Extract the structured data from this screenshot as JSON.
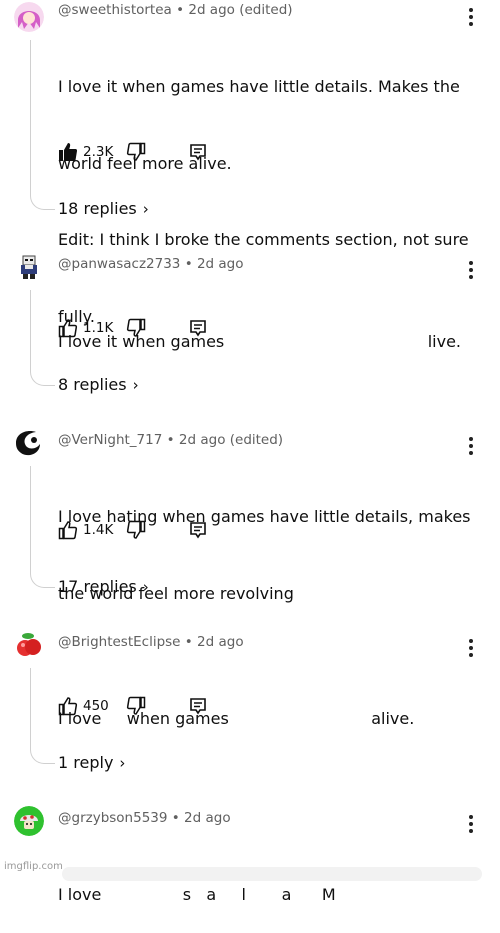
{
  "comments": [
    {
      "avatar": "pink-haired-anime-avatar",
      "handle": "@sweethistortea",
      "time": "2d ago (edited)",
      "lines": [
        "I love it when games have little details. Makes the",
        "world feel more alive.",
        "Edit: I think I broke the comments section, not sure",
        "fully."
      ],
      "likes": "2.3K",
      "liked": true,
      "replies": "18 replies"
    },
    {
      "avatar": "pixel-skeleton-avatar",
      "handle": "@panwasacz2733",
      "time": "2d ago",
      "lines": [
        "I love it when games                                        live."
      ],
      "likes": "1.1K",
      "liked": false,
      "replies": "8 replies"
    },
    {
      "avatar": "black-white-swirl-avatar",
      "handle": "@VerNight_717",
      "time": "2d ago (edited)",
      "lines": [
        "I love hating when games have little details, makes",
        "the world feel more revolving"
      ],
      "likes": "1.4K",
      "liked": false,
      "replies": "17 replies"
    },
    {
      "avatar": "red-berry-avatar",
      "handle": "@BrightestEclipse",
      "time": "2d ago",
      "lines": [
        "I love     when games                            alive."
      ],
      "likes": "450",
      "liked": false,
      "replies": "1 reply"
    },
    {
      "avatar": "green-mushroom-avatar",
      "handle": "@grzybson5539",
      "time": "2d ago",
      "lines": [
        "I love                s   a     l       a      M"
      ]
    }
  ],
  "separator": "•",
  "chevron": "›",
  "watermark": "imgflip.com",
  "colors": {
    "text": "#0f0f0f",
    "meta": "#606060",
    "thread": "#d0d0d0"
  }
}
